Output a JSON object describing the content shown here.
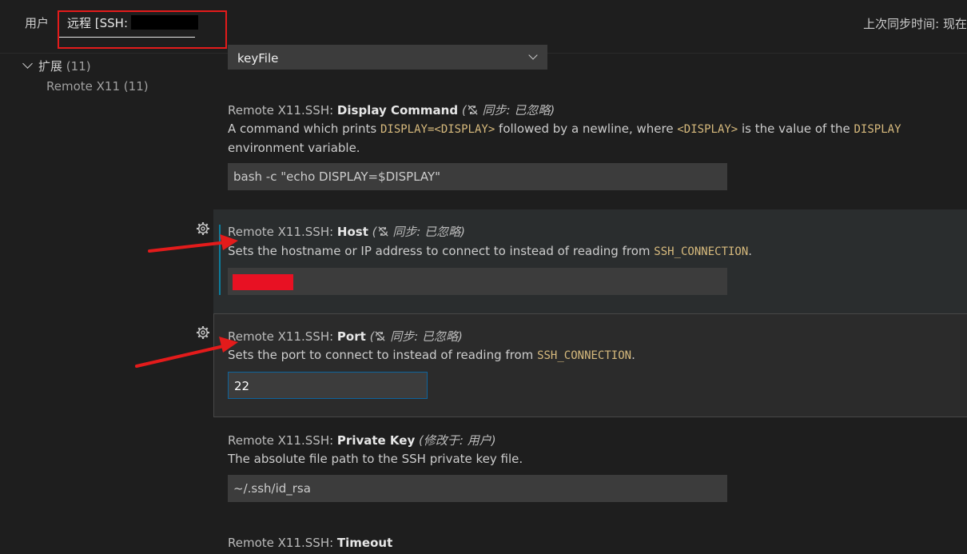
{
  "header": {
    "tab_user": "用户",
    "tab_remote": "远程 [SSH:",
    "sync_time": "上次同步时间: 现在"
  },
  "sidebar": {
    "group_label": "扩展",
    "group_count": "(11)",
    "item_label": "Remote X11",
    "item_count": "(11)"
  },
  "settings": {
    "top_select_value": "keyFile",
    "display_command": {
      "category": "Remote X11.SSH: ",
      "name": "Display Command",
      "sync_note": "同步: 已忽略",
      "desc_1": "A command which prints ",
      "code_1": "DISPLAY=<DISPLAY>",
      "desc_2": " followed by a newline, where ",
      "code_2": "<DISPLAY>",
      "desc_3": " is the value of the ",
      "code_3": "DISPLAY",
      "desc_4": " environment variable.",
      "value": "bash -c \"echo DISPLAY=$DISPLAY\""
    },
    "host": {
      "category": "Remote X11.SSH: ",
      "name": "Host",
      "sync_note": "同步: 已忽略",
      "desc_1": "Sets the hostname or IP address to connect to instead of reading from ",
      "code_1": "SSH_CONNECTION",
      "desc_2": "."
    },
    "port": {
      "category": "Remote X11.SSH: ",
      "name": "Port",
      "sync_note": "同步: 已忽略",
      "desc_1": "Sets the port to connect to instead of reading from ",
      "code_1": "SSH_CONNECTION",
      "desc_2": ".",
      "value": "22"
    },
    "private_key": {
      "category": "Remote X11.SSH: ",
      "name": "Private Key",
      "modified_note": "(修改于: 用户)",
      "desc": "The absolute file path to the SSH private key file.",
      "value": "~/.ssh/id_rsa"
    },
    "timeout": {
      "category": "Remote X11.SSH: ",
      "name": "Timeout"
    }
  },
  "colors": {
    "background": "#1e1e1e",
    "code": "#d7ba7d",
    "highlight_red": "#e31b1b",
    "focus_blue": "#0e639c",
    "modified_bar": "#0c7d9d"
  }
}
